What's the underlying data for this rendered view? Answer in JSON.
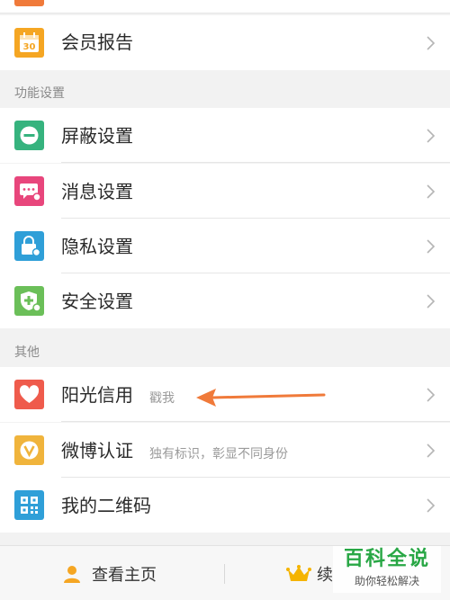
{
  "rows": {
    "member_report": {
      "label": "会员报告",
      "icon": "calendar-30-icon",
      "icon_text": "30",
      "color": "#f5a623"
    },
    "block": {
      "label": "屏蔽设置",
      "icon": "minus-circle-icon",
      "color": "#36b37e"
    },
    "message": {
      "label": "消息设置",
      "icon": "chat-settings-icon",
      "color": "#e8467c"
    },
    "privacy": {
      "label": "隐私设置",
      "icon": "lock-settings-icon",
      "color": "#2f9fd8"
    },
    "security": {
      "label": "安全设置",
      "icon": "shield-settings-icon",
      "color": "#6bbf59"
    },
    "sunshine_credit": {
      "label": "阳光信用",
      "sub": "戳我",
      "icon": "heart-icon",
      "color": "#ef5b4c"
    },
    "weibo_verify": {
      "label": "微博认证",
      "sub": "独有标识，彰显不同身份",
      "icon": "v-badge-icon",
      "color": "#f0b43c"
    },
    "qr_code": {
      "label": "我的二维码",
      "icon": "qr-code-icon",
      "color": "#2f9fd8"
    }
  },
  "sections": {
    "feature_settings": "功能设置",
    "other": "其他"
  },
  "bottom_bar": {
    "view_home": "查看主页",
    "renew": "续"
  },
  "watermark": {
    "title": "百科全说",
    "subtitle": "助你轻松解决"
  },
  "annotation": {
    "arrow_color": "#f07a3a"
  }
}
